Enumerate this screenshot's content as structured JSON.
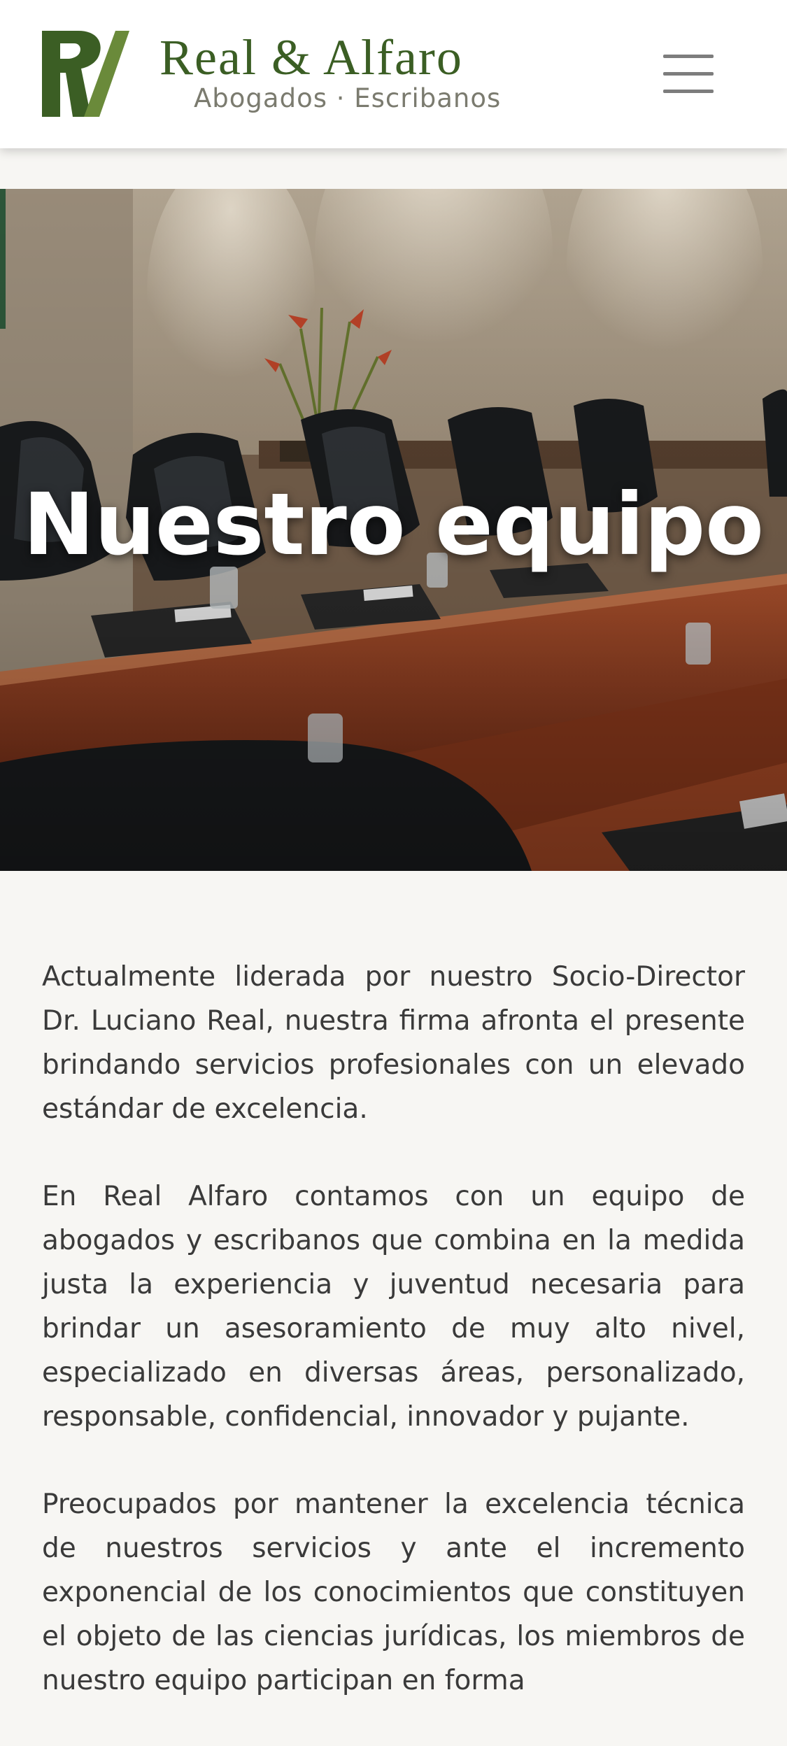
{
  "header": {
    "brand_name": "Real & Alfaro",
    "brand_tagline": "Abogados · Escribanos",
    "logo_icon": "rv-monogram-logo",
    "menu_icon": "hamburger-menu-icon",
    "brand_color": "#3b5e24",
    "brand_light_color": "#6a8a3a"
  },
  "hero": {
    "title": "Nuestro equipo",
    "background": "conference-room-photo"
  },
  "content": {
    "paragraphs": [
      "Actualmente liderada por nuestro Socio-Director Dr. Luciano Real, nuestra firma afronta el presente brindando servicios profesionales con un elevado estándar de excelencia.",
      "En Real Alfaro contamos con un equipo de abogados y escribanos que combina en la medida justa la experiencia y juventud necesaria para brindar un asesoramiento de muy alto nivel, especializado en diversas áreas, personalizado, responsable, confidencial, innovador y pujante.",
      "Preocupados por mantener la excelencia técnica de nuestros servicios y ante el incremento exponencial de los conocimientos que constituyen el objeto de las ciencias jurídicas, los miembros de nuestro equipo participan en forma"
    ]
  }
}
